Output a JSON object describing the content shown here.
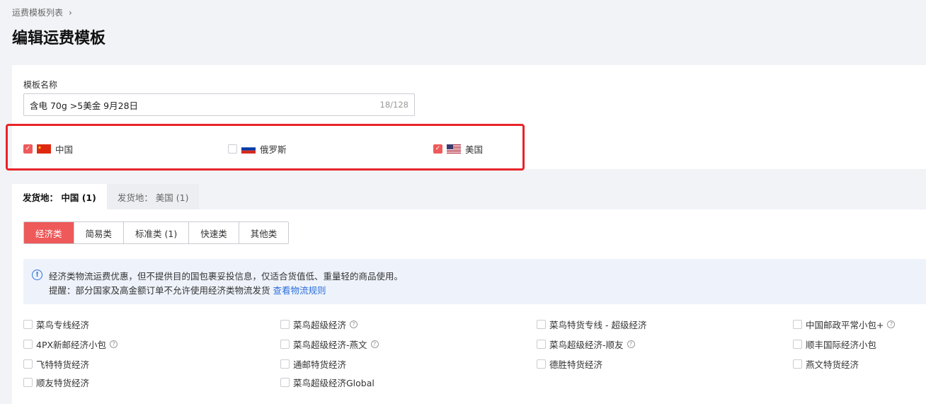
{
  "breadcrumb": {
    "parent": "运费模板列表"
  },
  "page": {
    "title": "编辑运费模板"
  },
  "template_name": {
    "label": "模板名称",
    "value": "含电 70g  >5美金 9月28日",
    "count": "18/128"
  },
  "countries": [
    {
      "name": "中国",
      "checked": true,
      "flag": "cn-flag-icon"
    },
    {
      "name": "俄罗斯",
      "checked": false,
      "flag": "ru-flag-icon"
    },
    {
      "name": "美国",
      "checked": true,
      "flag": "us-flag-icon"
    }
  ],
  "origin_tabs": [
    {
      "label": "发货地：  中国 (1)",
      "active": true
    },
    {
      "label": "发货地：  美国 (1)",
      "active": false
    }
  ],
  "categories": [
    {
      "label": "经济类",
      "active": true
    },
    {
      "label": "简易类",
      "active": false
    },
    {
      "label": "标准类 (1)",
      "active": false
    },
    {
      "label": "快速类",
      "active": false
    },
    {
      "label": "其他类",
      "active": false
    }
  ],
  "notice": {
    "line1": "经济类物流运费优惠，但不提供目的国包裹妥投信息，仅适合货值低、重量轻的商品使用。",
    "line2": "提醒：部分国家及高金额订单不允许使用经济类物流发货 ",
    "link": "查看物流规则"
  },
  "logistics": [
    [
      "菜鸟专线经济",
      "菜鸟超级经济",
      "菜鸟特货专线 - 超级经济",
      "中国邮政平常小包+"
    ],
    [
      "4PX新邮经济小包",
      "菜鸟超级经济-燕文",
      "菜鸟超级经济-顺友",
      "顺丰国际经济小包"
    ],
    [
      "飞特特货经济",
      "通邮特货经济",
      "德胜特货经济",
      "燕文特货经济"
    ],
    [
      "顺友特货经济",
      "菜鸟超级经济Global"
    ]
  ],
  "colors": {
    "accent": "#ee5a5a",
    "highlight_border": "#e8242a",
    "link": "#2c6edb"
  }
}
